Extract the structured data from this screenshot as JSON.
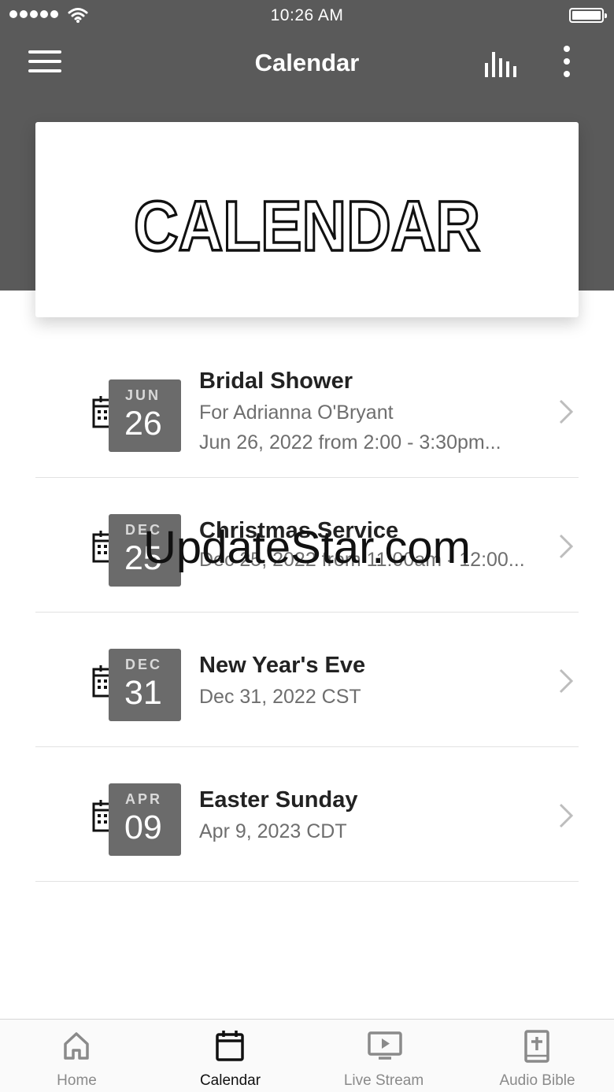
{
  "status_bar": {
    "time": "10:26 AM"
  },
  "nav": {
    "title": "Calendar"
  },
  "banner": {
    "text": "CALENDAR"
  },
  "events": [
    {
      "month": "JUN",
      "day": "26",
      "title": "Bridal Shower",
      "subtitle": "For Adrianna O'Bryant",
      "when": "Jun 26, 2022 from 2:00 - 3:30pm..."
    },
    {
      "month": "DEC",
      "day": "25",
      "title": "Christmas Service",
      "when": "Dec 25, 2022 from 11:00am - 12:00..."
    },
    {
      "month": "DEC",
      "day": "31",
      "title": "New Year's Eve",
      "when": "Dec 31, 2022 CST"
    },
    {
      "month": "APR",
      "day": "09",
      "title": "Easter Sunday",
      "when": "Apr 9, 2023 CDT"
    }
  ],
  "watermark": "UpdateStar.com",
  "tabs": [
    {
      "label": "Home",
      "icon": "home-icon",
      "active": false
    },
    {
      "label": "Calendar",
      "icon": "calendar-icon",
      "active": true
    },
    {
      "label": "Live Stream",
      "icon": "live-stream-icon",
      "active": false
    },
    {
      "label": "Audio Bible",
      "icon": "bible-icon",
      "active": false
    }
  ],
  "colors": {
    "header": "#5a5a5a",
    "date_tile": "#6b6b6b",
    "divider": "#e2e2e2"
  }
}
